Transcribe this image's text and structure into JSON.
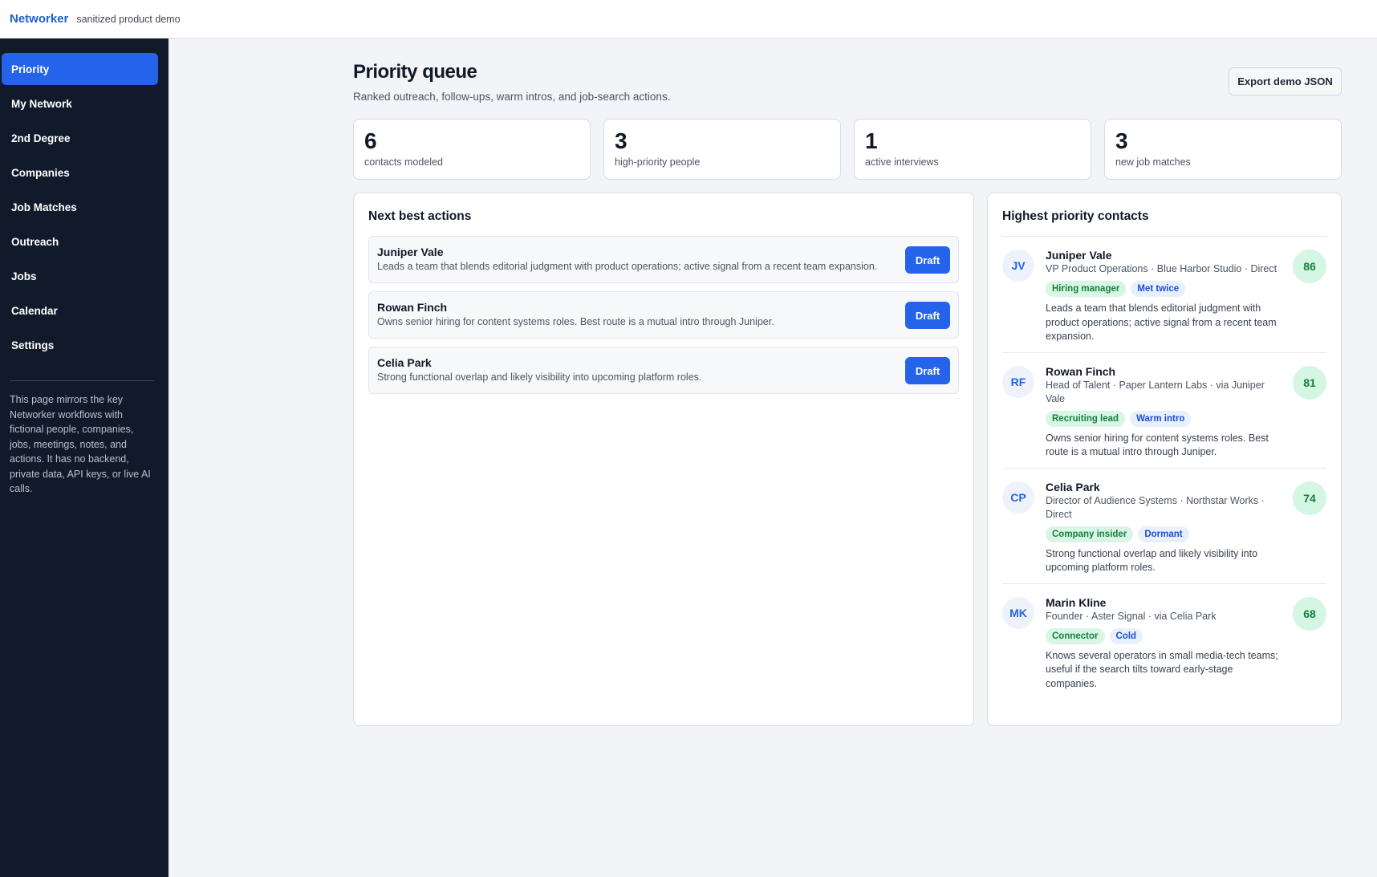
{
  "app": {
    "brand": "Networker",
    "subtitle": "sanitized product demo"
  },
  "sidebar": {
    "items": [
      {
        "label": "Priority",
        "active": true
      },
      {
        "label": "My Network"
      },
      {
        "label": "2nd Degree"
      },
      {
        "label": "Companies"
      },
      {
        "label": "Job Matches"
      },
      {
        "label": "Outreach"
      },
      {
        "label": "Jobs"
      },
      {
        "label": "Calendar"
      },
      {
        "label": "Settings"
      }
    ],
    "note": "This page mirrors the key Networker workflows with fictional people, companies, jobs, meetings, notes, and actions. It has no backend, private data, API keys, or live AI calls."
  },
  "header": {
    "title": "Priority queue",
    "subtitle": "Ranked outreach, follow-ups, warm intros, and job-search actions.",
    "export_label": "Export demo JSON"
  },
  "stats": [
    {
      "value": "6",
      "label": "contacts modeled"
    },
    {
      "value": "3",
      "label": "high-priority people"
    },
    {
      "value": "1",
      "label": "active interviews"
    },
    {
      "value": "3",
      "label": "new job matches"
    }
  ],
  "actions": {
    "title": "Next best actions",
    "button_label": "Draft",
    "items": [
      {
        "name": "Juniper Vale",
        "desc": "Leads a team that blends editorial judgment with product operations; active signal from a recent team expansion."
      },
      {
        "name": "Rowan Finch",
        "desc": "Owns senior hiring for content systems roles. Best route is a mutual intro through Juniper."
      },
      {
        "name": "Celia Park",
        "desc": "Strong functional overlap and likely visibility into upcoming platform roles."
      }
    ]
  },
  "contacts": {
    "title": "Highest priority contacts",
    "items": [
      {
        "initials": "JV",
        "name": "Juniper Vale",
        "meta": "VP Product Operations · Blue Harbor Studio · Direct",
        "tag1": "Hiring manager",
        "tag2": "Met twice",
        "desc": "Leads a team that blends editorial judgment with product operations; active signal from a recent team expansion.",
        "score": "86"
      },
      {
        "initials": "RF",
        "name": "Rowan Finch",
        "meta": "Head of Talent · Paper Lantern Labs · via Juniper Vale",
        "tag1": "Recruiting lead",
        "tag2": "Warm intro",
        "desc": "Owns senior hiring for content systems roles. Best route is a mutual intro through Juniper.",
        "score": "81"
      },
      {
        "initials": "CP",
        "name": "Celia Park",
        "meta": "Director of Audience Systems · Northstar Works · Direct",
        "tag1": "Company insider",
        "tag2": "Dormant",
        "desc": "Strong functional overlap and likely visibility into upcoming platform roles.",
        "score": "74"
      },
      {
        "initials": "MK",
        "name": "Marin Kline",
        "meta": "Founder · Aster Signal · via Celia Park",
        "tag1": "Connector",
        "tag2": "Cold",
        "desc": "Knows several operators in small media-tech teams; useful if the search tilts toward early-stage companies.",
        "score": "68"
      }
    ]
  },
  "colors": {
    "accent": "#2563eb",
    "sidebar_bg": "#111a2b",
    "score_bg": "#d4f6e3",
    "score_fg": "#15803d"
  }
}
